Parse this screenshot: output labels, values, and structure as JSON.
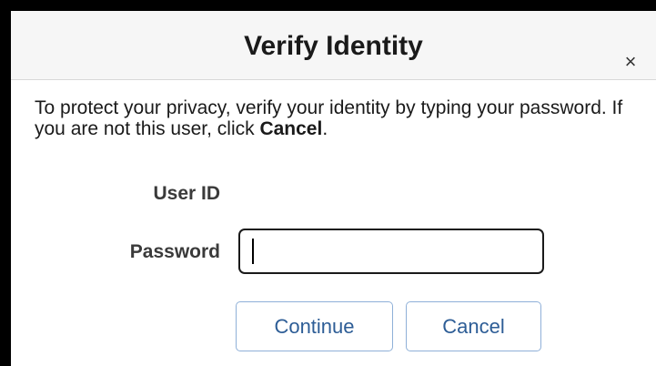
{
  "dialog": {
    "title": "Verify Identity",
    "close_glyph": "×",
    "close_icon": "close-icon",
    "message_part1": "To protect your privacy, verify your identity by typing your password. If you are not this user, click ",
    "message_bold": "Cancel",
    "message_part2": "."
  },
  "form": {
    "userid_label": "User ID",
    "password_label": "Password",
    "password_value": ""
  },
  "buttons": {
    "continue_label": "Continue",
    "cancel_label": "Cancel"
  },
  "colors": {
    "titlebar_bg": "#f6f6f6",
    "button_text": "#2d5d96",
    "button_border": "#8fb0d8"
  }
}
